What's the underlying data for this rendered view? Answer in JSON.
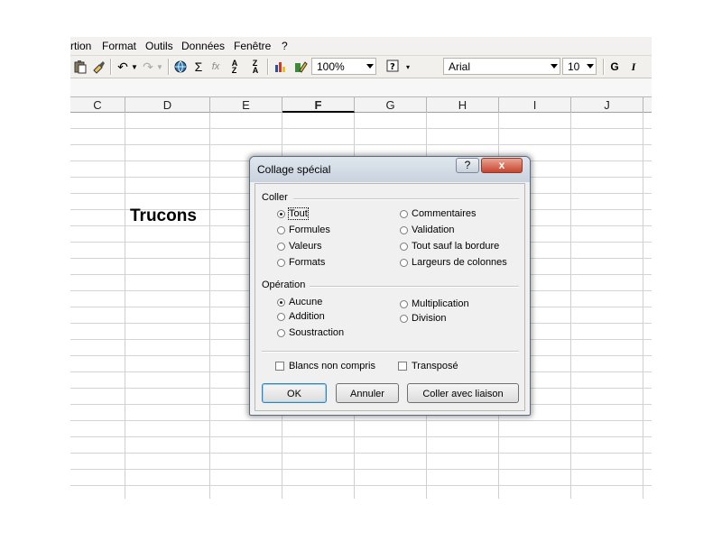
{
  "menu": [
    "rtion",
    "Format",
    "Outils",
    "Données",
    "Fenêtre",
    "?"
  ],
  "toolbar": {
    "zoom": "100%",
    "font": "Arial",
    "font_size": "10",
    "bold": "G",
    "italic": "I"
  },
  "columns": [
    "C",
    "D",
    "E",
    "F",
    "G",
    "H",
    "I",
    "J"
  ],
  "active_column": "F",
  "cell": {
    "ref": "D8",
    "text": "Trucons"
  },
  "dialog": {
    "title": "Collage spécial",
    "help_label": "?",
    "close_label": "x",
    "coller": {
      "label": "Coller",
      "options": [
        {
          "label": "Tout",
          "checked": true
        },
        {
          "label": "Formules",
          "checked": false
        },
        {
          "label": "Valeurs",
          "checked": false
        },
        {
          "label": "Formats",
          "checked": false
        },
        {
          "label": "Commentaires",
          "checked": false
        },
        {
          "label": "Validation",
          "checked": false
        },
        {
          "label": "Tout sauf la bordure",
          "checked": false
        },
        {
          "label": "Largeurs de colonnes",
          "checked": false
        }
      ]
    },
    "operation": {
      "label": "Opération",
      "options": [
        {
          "label": "Aucune",
          "checked": true
        },
        {
          "label": "Addition",
          "checked": false
        },
        {
          "label": "Soustraction",
          "checked": false
        },
        {
          "label": "Multiplication",
          "checked": false
        },
        {
          "label": "Division",
          "checked": false
        }
      ]
    },
    "checkboxes": [
      {
        "label": "Blancs non compris",
        "checked": false
      },
      {
        "label": "Transposé",
        "checked": false
      }
    ],
    "buttons": {
      "ok": "OK",
      "cancel": "Annuler",
      "paste_link": "Coller avec liaison"
    }
  }
}
